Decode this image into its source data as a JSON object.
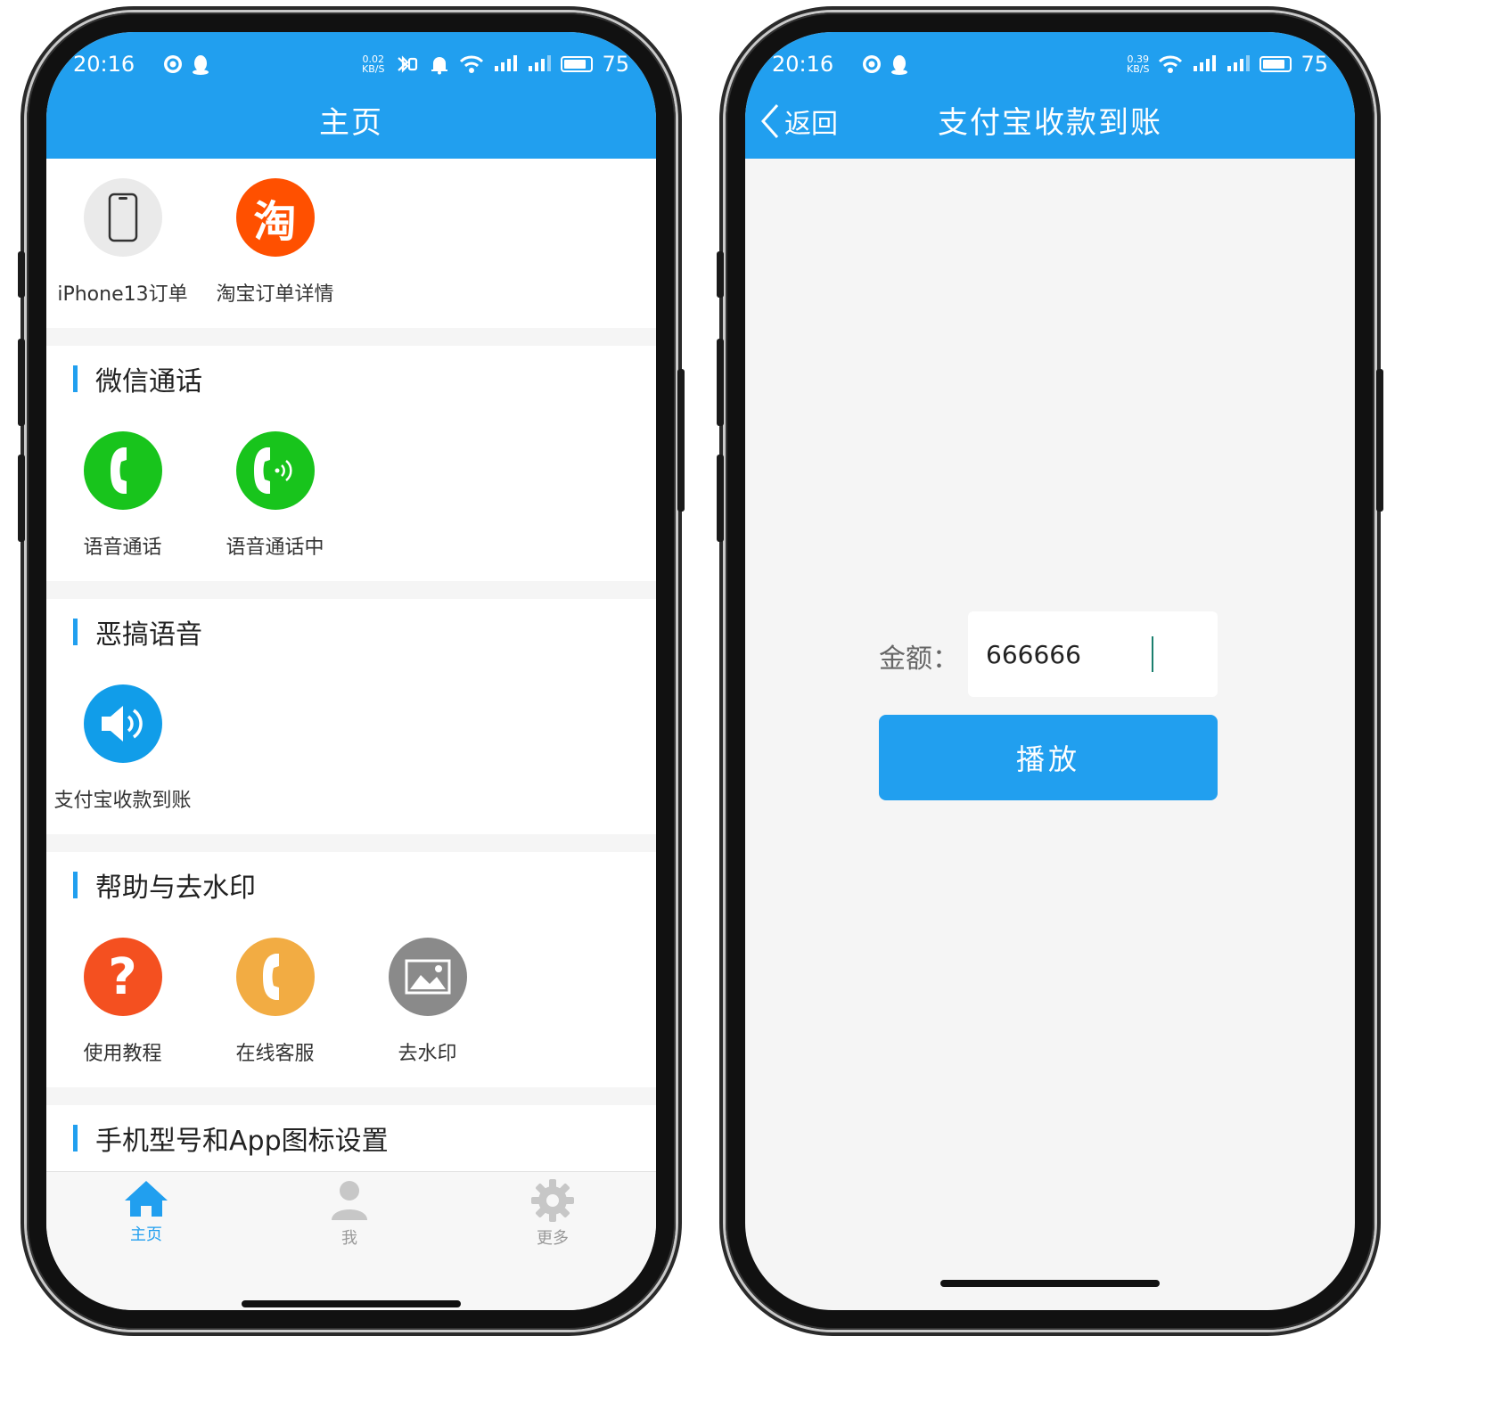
{
  "status_left": {
    "time": "20:16",
    "netspeed_value": "0.02",
    "netspeed_unit": "KB/S",
    "battery": "75"
  },
  "status_right": {
    "time": "20:16",
    "netspeed_value": "0.39",
    "netspeed_unit": "KB/S",
    "battery": "75"
  },
  "colors": {
    "accent": "#219fef",
    "wechat_green": "#18c41c",
    "taobao_orange": "#ff5000",
    "help_red": "#f45020",
    "service_orange": "#f2ac43",
    "watermark_gray": "#8a8a8a"
  },
  "home": {
    "title": "主页",
    "top_items": [
      {
        "label": "iPhone13订单",
        "icon": "phone-icon"
      },
      {
        "label": "淘宝订单详情",
        "icon": "taobao-icon",
        "glyph": "淘"
      }
    ],
    "sections": [
      {
        "title": "微信通话",
        "items": [
          {
            "label": "语音通话",
            "icon": "call-icon"
          },
          {
            "label": "语音通话中",
            "icon": "call-active-icon"
          }
        ]
      },
      {
        "title": "恶搞语音",
        "items": [
          {
            "label": "支付宝收款到账",
            "icon": "speaker-icon"
          }
        ]
      },
      {
        "title": "帮助与去水印",
        "items": [
          {
            "label": "使用教程",
            "icon": "question-icon",
            "glyph": "?"
          },
          {
            "label": "在线客服",
            "icon": "headset-call-icon"
          },
          {
            "label": "去水印",
            "icon": "image-icon"
          }
        ]
      },
      {
        "title": "手机型号和App图标设置"
      }
    ],
    "tabs": [
      {
        "label": "主页",
        "icon": "home-icon",
        "active": true
      },
      {
        "label": "我",
        "icon": "user-icon",
        "active": false
      },
      {
        "label": "更多",
        "icon": "gear-icon",
        "active": false
      }
    ]
  },
  "detail": {
    "back_label": "返回",
    "title": "支付宝收款到账",
    "amount_label": "金额：",
    "amount_value": "666666",
    "play_label": "播放"
  }
}
